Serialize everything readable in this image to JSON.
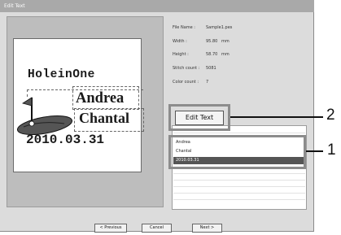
{
  "window": {
    "title": "Edit Text"
  },
  "design": {
    "lines": [
      "HoleinOne",
      "Andrea",
      "Chantal",
      "2010.03.31"
    ]
  },
  "info": {
    "file_name_label": "File Name :",
    "file_name_value": "Sample1.pes",
    "width_label": "Width :",
    "width_value": "95.80",
    "width_unit": "mm",
    "height_label": "Height :",
    "height_value": "58.70",
    "height_unit": "mm",
    "stitch_label": "Stitch count :",
    "stitch_value": "5081",
    "color_label": "Color count :",
    "color_value": "7"
  },
  "edit_text_button": "Edit Text",
  "text_list": {
    "items": [
      "Andrea",
      "Chantal",
      "2010.03.31"
    ],
    "selected_index": 2
  },
  "buttons": {
    "previous": "< Previous",
    "cancel": "Cancel",
    "next": "Next >"
  },
  "callouts": {
    "edit_button_number": "2",
    "list_number": "1"
  }
}
